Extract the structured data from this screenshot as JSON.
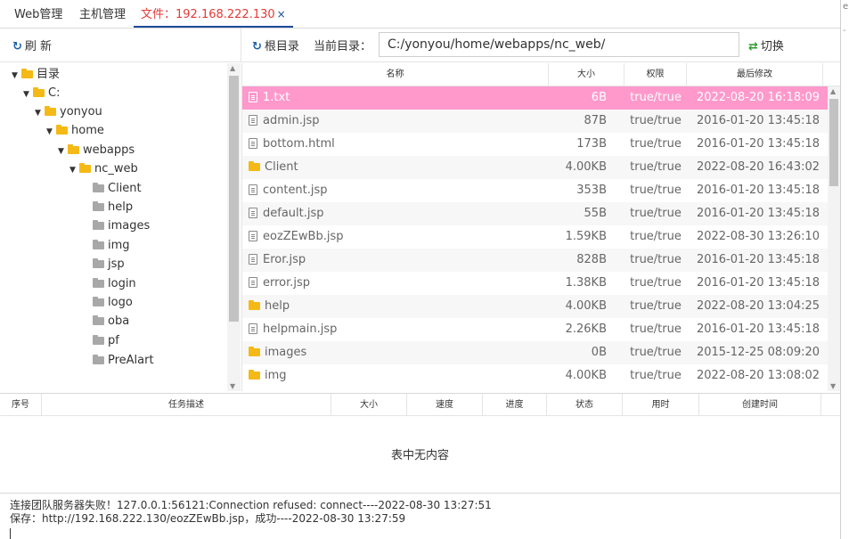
{
  "tabs": [
    {
      "label": "Web管理"
    },
    {
      "label": "主机管理"
    },
    {
      "label": "文件：192.168.222.130",
      "close": "×"
    }
  ],
  "toolbar": {
    "refresh_label": "刷 新",
    "root_label": "根目录",
    "current_dir_label": "当前目录：",
    "path_value": "C:/yonyou/home/webapps/nc_web/",
    "switch_label": "切换"
  },
  "tree": {
    "items": [
      {
        "label": "目录",
        "expanded": true,
        "color": "yellow"
      },
      {
        "label": "C:",
        "expanded": true,
        "color": "yellow"
      },
      {
        "label": "yonyou",
        "expanded": true,
        "color": "yellow"
      },
      {
        "label": "home",
        "expanded": true,
        "color": "yellow"
      },
      {
        "label": "webapps",
        "expanded": true,
        "color": "yellow"
      },
      {
        "label": "nc_web",
        "expanded": true,
        "color": "yellow"
      },
      {
        "label": "Client",
        "color": "grey"
      },
      {
        "label": "help",
        "color": "grey"
      },
      {
        "label": "images",
        "color": "grey"
      },
      {
        "label": "img",
        "color": "grey"
      },
      {
        "label": "jsp",
        "color": "grey"
      },
      {
        "label": "login",
        "color": "grey"
      },
      {
        "label": "logo",
        "color": "grey"
      },
      {
        "label": "oba",
        "color": "grey"
      },
      {
        "label": "pf",
        "color": "grey"
      },
      {
        "label": "PreAlart",
        "color": "grey"
      }
    ]
  },
  "grid": {
    "headers": {
      "name": "名称",
      "size": "大小",
      "perm": "权限",
      "modified": "最后修改"
    },
    "rows": [
      {
        "name": "1.txt",
        "type": "file",
        "size": "6B",
        "perm": "true/true",
        "modified": "2022-08-20 16:18:09"
      },
      {
        "name": "admin.jsp",
        "type": "file",
        "size": "87B",
        "perm": "true/true",
        "modified": "2016-01-20 13:45:18"
      },
      {
        "name": "bottom.html",
        "type": "file",
        "size": "173B",
        "perm": "true/true",
        "modified": "2016-01-20 13:45:18"
      },
      {
        "name": "Client",
        "type": "folder",
        "size": "4.00KB",
        "perm": "true/true",
        "modified": "2022-08-20 16:43:02"
      },
      {
        "name": "content.jsp",
        "type": "file",
        "size": "353B",
        "perm": "true/true",
        "modified": "2016-01-20 13:45:18"
      },
      {
        "name": "default.jsp",
        "type": "file",
        "size": "55B",
        "perm": "true/true",
        "modified": "2016-01-20 13:45:18"
      },
      {
        "name": "eozZEwBb.jsp",
        "type": "file",
        "size": "1.59KB",
        "perm": "true/true",
        "modified": "2022-08-30 13:26:10"
      },
      {
        "name": "Eror.jsp",
        "type": "file",
        "size": "828B",
        "perm": "true/true",
        "modified": "2016-01-20 13:45:18"
      },
      {
        "name": "error.jsp",
        "type": "file",
        "size": "1.38KB",
        "perm": "true/true",
        "modified": "2016-01-20 13:45:18"
      },
      {
        "name": "help",
        "type": "folder",
        "size": "4.00KB",
        "perm": "true/true",
        "modified": "2022-08-20 13:04:25"
      },
      {
        "name": "helpmain.jsp",
        "type": "file",
        "size": "2.26KB",
        "perm": "true/true",
        "modified": "2016-01-20 13:45:18"
      },
      {
        "name": "images",
        "type": "folder",
        "size": "0B",
        "perm": "true/true",
        "modified": "2015-12-25 08:09:20"
      },
      {
        "name": "img",
        "type": "folder",
        "size": "4.00KB",
        "perm": "true/true",
        "modified": "2022-08-20 13:08:02"
      }
    ]
  },
  "tasks": {
    "headers": [
      "序号",
      "任务描述",
      "大小",
      "速度",
      "进度",
      "状态",
      "用时",
      "创建时间"
    ],
    "empty_text": "表中无内容"
  },
  "log": {
    "lines": [
      "连接团队服务器失败！127.0.0.1:56121:Connection refused: connect----2022-08-30 13:27:51",
      "保存：http://192.168.222.130/eozZEwBb.jsp，成功----2022-08-30 13:27:59"
    ]
  },
  "colors": {
    "selected_row": "#ff99cc",
    "active_tab_text": "#e53935",
    "active_tab_underline": "#1e4b9b",
    "folder": "#f5b916"
  }
}
